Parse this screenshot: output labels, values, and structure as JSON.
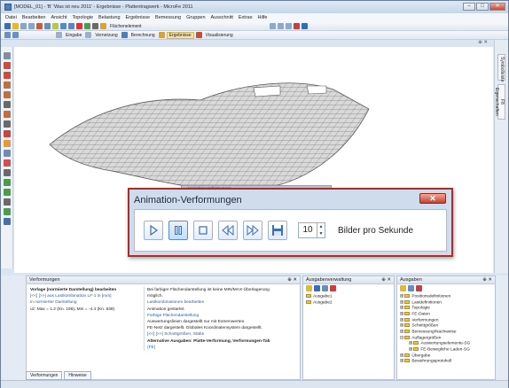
{
  "window": {
    "title": "[MODEL_01] - 'B' 'Was ist neu 2011' - Ergebnisse - Plattentragwerk - MicroFe 2011"
  },
  "menu": [
    "Datei",
    "Bearbeiten",
    "Ansicht",
    "Topologie",
    "Belastung",
    "Ergebnisse",
    "Bemessung",
    "Gruppen",
    "Ausschnitt",
    "Extras",
    "Hilfe"
  ],
  "toolbar": {
    "flaechenelement": "Flächenelement",
    "eingabe": "Eingabe",
    "vernetzung": "Vernetzung",
    "berechnung": "Berechnung",
    "ergebnisse": "Ergebnisse",
    "visualisierung": "Visualisierung"
  },
  "right_tabs": {
    "symbolleiste": "Symbolleiste",
    "eigenschaften": "F8 Eigenschaften"
  },
  "dialog": {
    "title": "Animation-Verformungen",
    "close": "✕",
    "frames_value": "10",
    "frames_label": "Bilder pro Sekunde"
  },
  "behind_dialog_title": "Animation-Verformungen",
  "panes": {
    "verformungen": {
      "title": "Verformungen",
      "pin": "⊕ ✕",
      "left_lines": [
        "Vorlage (normierte Darstellung) bearbeiten",
        "",
        "[<<] [>>] aus Lastkombination LF-1 in [mm]",
        "in normierter Darstellung",
        "uz: Max = 1.2 (Kn. 196), Min = -4.4 (Kn. 539)"
      ],
      "right_lines": [
        "Bei farbiger Flächendarstellung ist keine MIN/MAX-Überlagerung",
        "möglich.",
        "Lastkombinationen bearbeiten",
        "Animation gestartet.",
        "Farbige Flächendarstellung",
        "Auswertungslinien dargestellt nur mit Extremwerten.",
        "FE-Netz dargestellt. Globales Koordinatensystem dargestellt.",
        "[<<] [>>] Schnittgrößen, Stäbe",
        "",
        "Alternative Ausgaben: Platte-Verformung, Verformungen-Tab",
        "(FE)"
      ]
    },
    "ausgabenverwaltung": {
      "title": "Ausgabenverwaltung",
      "pin": "⊕ ✕",
      "items": [
        "Ausgabe1",
        "Ausgabe2"
      ]
    },
    "ausgaben": {
      "title": "Ausgaben",
      "pin": "⊕ ✕",
      "items": [
        "Positionsdefinitionen",
        "Lastdefinitionen",
        "Topologie",
        "FE-Daten",
        "Verformungen",
        "Schnittgrößen",
        "Bemessung/Nachweise",
        "Auflagergrößen",
        "Auswertungselemente-SG",
        "FE-Bewegliche Laden-SG",
        "Übergabe",
        "Bewehrungsprotokoll"
      ]
    }
  },
  "pane_tabs": [
    "Verformungen",
    "Hinweise"
  ],
  "colors": {
    "dialog_border": "#b12a2a",
    "mesh": "#777777",
    "accent": "#2a5db0"
  }
}
